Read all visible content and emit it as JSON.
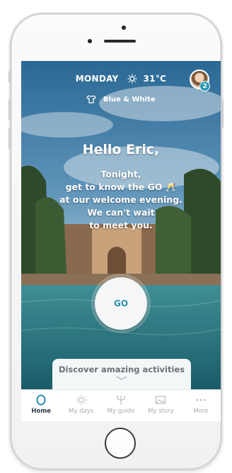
{
  "header": {
    "day": "MONDAY",
    "temperature": "31°C",
    "outfit": "Blue & White",
    "notification_count": "2"
  },
  "main": {
    "greeting": "Hello Eric,",
    "message_lines": [
      "Tonight,",
      "get to know the GO 🥂",
      "at our welcome evening.",
      "We can't wait",
      "to meet you."
    ],
    "go_label": "GO",
    "discover_label": "Discover amazing activities"
  },
  "tabs": [
    {
      "label": "Home",
      "icon": "home-ring-icon",
      "active": true
    },
    {
      "label": "My days",
      "icon": "sun-icon",
      "active": false
    },
    {
      "label": "My guide",
      "icon": "trident-icon",
      "active": false
    },
    {
      "label": "My story",
      "icon": "photo-icon",
      "active": false
    },
    {
      "label": "More",
      "icon": "more-dots-icon",
      "active": false
    }
  ],
  "colors": {
    "accent": "#2f8fb0",
    "badge": "#2a9ab3",
    "tab_active": "#2b3b4a",
    "tab_inactive": "#a9adb1"
  }
}
